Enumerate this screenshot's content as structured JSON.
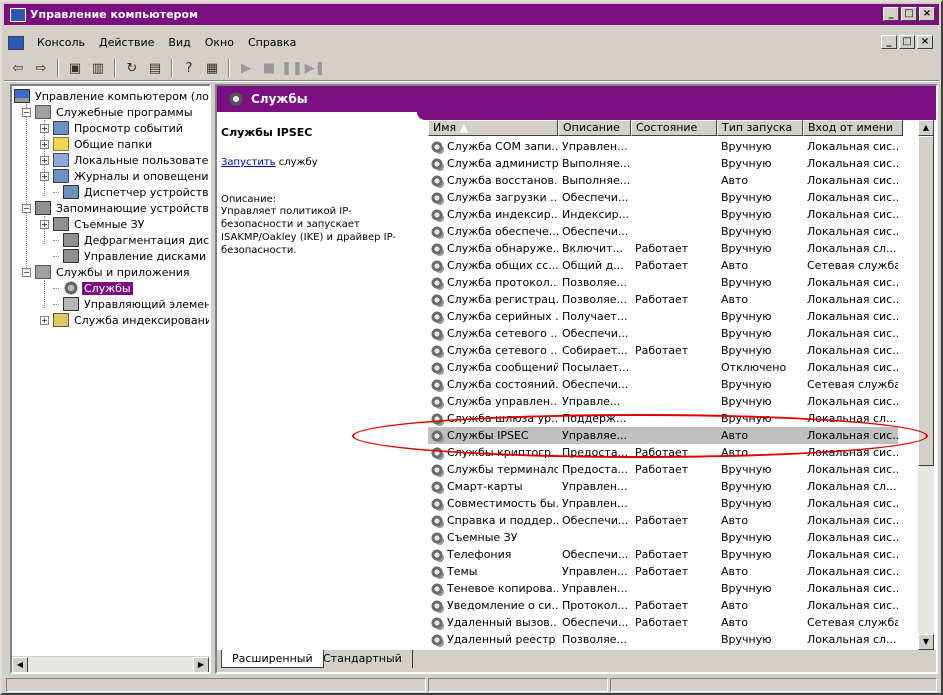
{
  "window": {
    "title": "Управление компьютером",
    "minimize": "_",
    "maximize": "□",
    "close": "×"
  },
  "menu": [
    "Консоль",
    "Действие",
    "Вид",
    "Окно",
    "Справка"
  ],
  "toolbar_icons": [
    "back-arrow-icon",
    "forward-arrow-icon",
    "up-folder-icon",
    "show-tree-icon",
    "refresh-icon",
    "export-list-icon",
    "help-icon",
    "properties-icon",
    "play-icon",
    "stop-icon",
    "pause-icon",
    "restart-icon"
  ],
  "tree": {
    "items": [
      {
        "label": "Управление компьютером (локаль",
        "icon": "computer-icon",
        "level": 0,
        "expander": ""
      },
      {
        "label": "Служебные программы",
        "icon": "tools-icon",
        "level": 1,
        "expander": "−"
      },
      {
        "label": "Просмотр событий",
        "icon": "event-viewer-icon",
        "level": 2,
        "expander": "+"
      },
      {
        "label": "Общие папки",
        "icon": "shared-folders-icon",
        "level": 2,
        "expander": "+"
      },
      {
        "label": "Локальные пользователи",
        "icon": "users-icon",
        "level": 2,
        "expander": "+"
      },
      {
        "label": "Журналы и оповещения пр",
        "icon": "logs-icon",
        "level": 2,
        "expander": "+"
      },
      {
        "label": "Диспетчер устройств",
        "icon": "device-manager-icon",
        "level": 2,
        "expander": ""
      },
      {
        "label": "Запоминающие устройства",
        "icon": "storage-icon",
        "level": 1,
        "expander": "−"
      },
      {
        "label": "Съемные ЗУ",
        "icon": "removable-storage-icon",
        "level": 2,
        "expander": "+"
      },
      {
        "label": "Дефрагментация диска",
        "icon": "defrag-icon",
        "level": 2,
        "expander": ""
      },
      {
        "label": "Управление дисками",
        "icon": "disk-management-icon",
        "level": 2,
        "expander": ""
      },
      {
        "label": "Службы и приложения",
        "icon": "services-apps-icon",
        "level": 1,
        "expander": "−"
      },
      {
        "label": "Службы",
        "icon": "services-icon",
        "level": 2,
        "expander": "",
        "selected": true
      },
      {
        "label": "Управляющий элемент WM",
        "icon": "wmi-icon",
        "level": 2,
        "expander": ""
      },
      {
        "label": "Служба индексирования",
        "icon": "indexing-icon",
        "level": 2,
        "expander": "+"
      }
    ]
  },
  "pane": {
    "header": "Службы",
    "selected_name": "Службы IPSEC",
    "start_link": "Запустить",
    "start_suffix": " службу",
    "desc_label": "Описание:",
    "desc_text": "Управляет политикой IP-безопасности и запускает ISAKMP/Oakley (IKE) и драйвер IP-безопасности."
  },
  "columns": [
    "Имя",
    "Описание",
    "Состояние",
    "Тип запуска",
    "Вход от имени"
  ],
  "sort_indicator": "▲",
  "services": [
    [
      "Служба COM запи...",
      "Управлен...",
      "",
      "Вручную",
      "Локальная сис..."
    ],
    [
      "Служба администр...",
      "Выполняе...",
      "",
      "Вручную",
      "Локальная сис..."
    ],
    [
      "Служба восстанов...",
      "Выполняе...",
      "",
      "Авто",
      "Локальная сис..."
    ],
    [
      "Служба загрузки ...",
      "Обеспечи...",
      "",
      "Вручную",
      "Локальная сис..."
    ],
    [
      "Служба индексир...",
      "Индексир...",
      "",
      "Вручную",
      "Локальная сис..."
    ],
    [
      "Служба обеспече...",
      "Обеспечи...",
      "",
      "Вручную",
      "Локальная сис..."
    ],
    [
      "Служба обнаруже...",
      "Включит...",
      "Работает",
      "Вручную",
      "Локальная сл..."
    ],
    [
      "Служба общих сс...",
      "Общий д...",
      "Работает",
      "Авто",
      "Сетевая служба"
    ],
    [
      "Служба протокол...",
      "Позволяе...",
      "",
      "Вручную",
      "Локальная сис..."
    ],
    [
      "Служба регистрац...",
      "Позволяе...",
      "Работает",
      "Авто",
      "Локальная сис..."
    ],
    [
      "Служба серийных ...",
      "Получает...",
      "",
      "Вручную",
      "Локальная сис..."
    ],
    [
      "Служба сетевого ...",
      "Обеспечи...",
      "",
      "Вручную",
      "Локальная сис..."
    ],
    [
      "Служба сетевого ...",
      "Собирает...",
      "Работает",
      "Вручную",
      "Локальная сис..."
    ],
    [
      "Служба сообщений",
      "Посылает...",
      "",
      "Отключено",
      "Локальная сис..."
    ],
    [
      "Служба состояний...",
      "Обеспечи...",
      "",
      "Вручную",
      "Сетевая служба"
    ],
    [
      "Служба управлен...",
      "Управле...",
      "",
      "Вручную",
      "Локальная сис..."
    ],
    [
      "Служба шлюза ур...",
      "Поддерж...",
      "",
      "Вручную",
      "Локальная сл..."
    ],
    [
      "Службы IPSEC",
      "Управляе...",
      "",
      "Авто",
      "Локальная сис..."
    ],
    [
      "Службы криптогр...",
      "Предоста...",
      "Работает",
      "Авто",
      "Локальная сис..."
    ],
    [
      "Службы терминалов",
      "Предоста...",
      "Работает",
      "Вручную",
      "Локальная сис..."
    ],
    [
      "Смарт-карты",
      "Управлен...",
      "",
      "Вручную",
      "Локальная сл..."
    ],
    [
      "Совместимость бы...",
      "Управлен...",
      "",
      "Вручную",
      "Локальная сис..."
    ],
    [
      "Справка и поддер...",
      "Обеспечи...",
      "Работает",
      "Авто",
      "Локальная сис..."
    ],
    [
      "Съемные ЗУ",
      "",
      "",
      "Вручную",
      "Локальная сис..."
    ],
    [
      "Телефония",
      "Обеспечи...",
      "Работает",
      "Вручную",
      "Локальная сис..."
    ],
    [
      "Темы",
      "Управлен...",
      "Работает",
      "Авто",
      "Локальная сис..."
    ],
    [
      "Теневое копирова...",
      "Управлен...",
      "",
      "Вручную",
      "Локальная сис..."
    ],
    [
      "Уведомление о си...",
      "Протокол...",
      "Работает",
      "Авто",
      "Локальная сис..."
    ],
    [
      "Удаленный вызов...",
      "Обеспечи...",
      "Работает",
      "Авто",
      "Сетевая служба"
    ],
    [
      "Удаленный реестр",
      "Позволяе...",
      "",
      "Вручную",
      "Локальная сл..."
    ]
  ],
  "highlighted_row": 17,
  "tabs": [
    "Расширенный",
    "Стандартный"
  ],
  "colors": {
    "accent": "#7b0f82",
    "annotation": "#e00000"
  }
}
